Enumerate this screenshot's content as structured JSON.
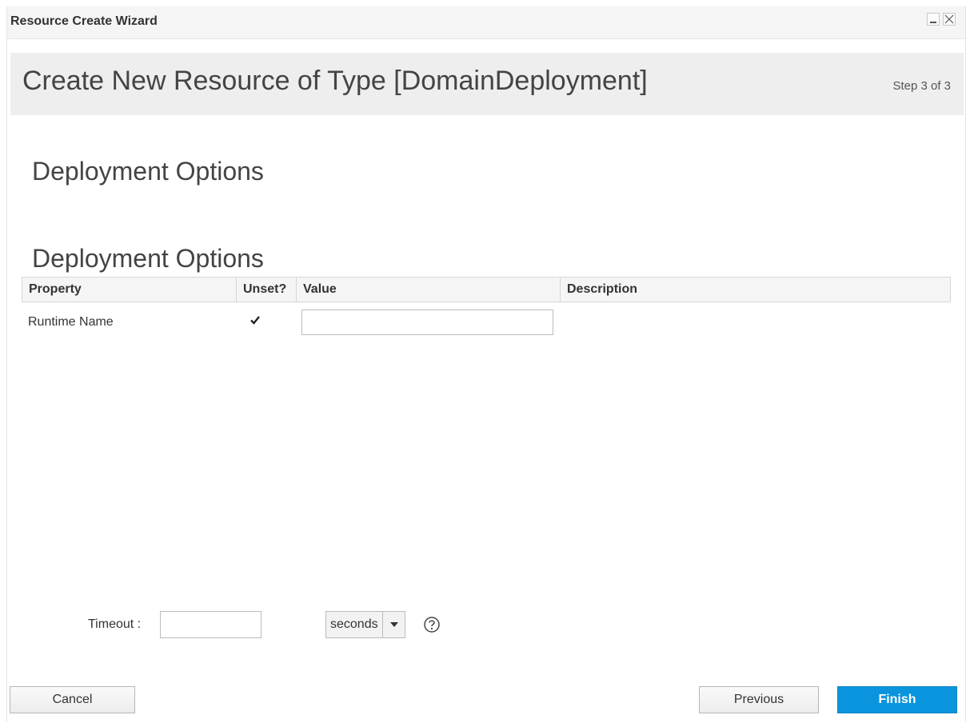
{
  "window": {
    "title": "Resource Create Wizard"
  },
  "header": {
    "title": "Create New Resource of Type [DomainDeployment]",
    "step": "Step 3 of 3"
  },
  "section": {
    "title": "Deployment Options",
    "grid_title": "Deployment Options"
  },
  "grid": {
    "columns": [
      "Property",
      "Unset?",
      "Value",
      "Description"
    ],
    "rows": [
      {
        "property": "Runtime Name",
        "unset": true,
        "value": "",
        "description": ""
      }
    ]
  },
  "timeout": {
    "label": "Timeout :",
    "value": "",
    "unit": "seconds"
  },
  "buttons": {
    "cancel": "Cancel",
    "previous": "Previous",
    "finish": "Finish"
  },
  "colors": {
    "primary": "#0a94dd",
    "header_bg": "#eeeeee"
  }
}
